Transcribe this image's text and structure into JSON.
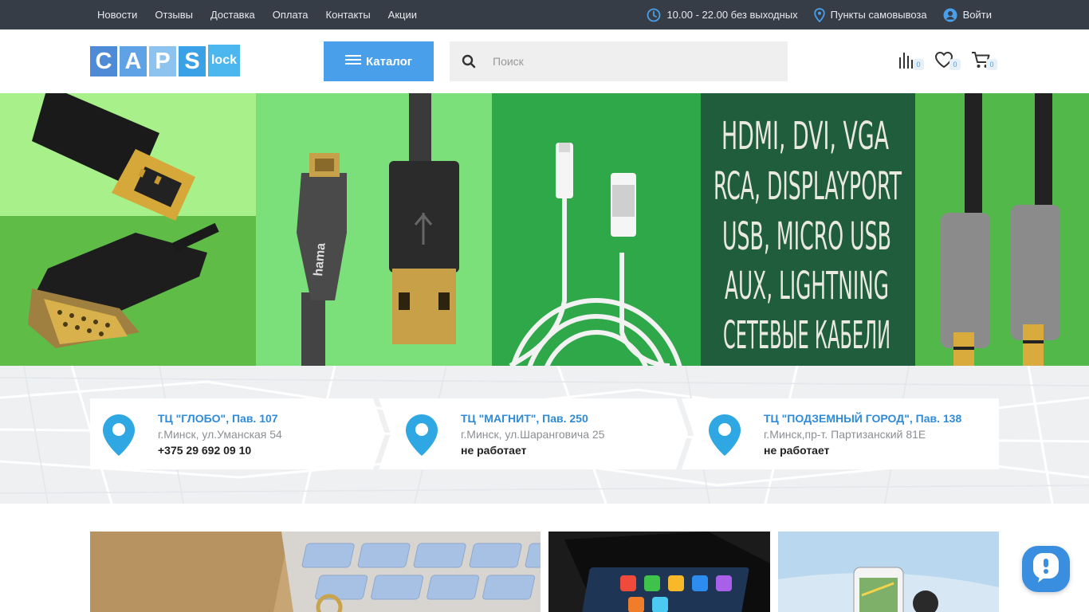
{
  "topbar": {
    "nav": [
      "Новости",
      "Отзывы",
      "Доставка",
      "Оплата",
      "Контакты",
      "Акции"
    ],
    "hours": "10.00 - 22.00 без выходных",
    "pickup": "Пункты самовывоза",
    "login": "Войти"
  },
  "header": {
    "logo_letters": [
      "C",
      "A",
      "P",
      "S"
    ],
    "logo_suffix": "lock",
    "catalog_label": "Каталог",
    "search_placeholder": "Поиск",
    "compare_count": "0",
    "favorites_count": "0",
    "cart_count": "0"
  },
  "banner": {
    "lines": [
      "HDMI, DVI, VGA",
      "RCA, DISPLAYPORT",
      "USB, MICRO USB",
      "AUX, LIGHTNING",
      "СЕТЕВЫЕ КАБЕЛИ"
    ],
    "slides": 4,
    "active_slide": 1
  },
  "stores": [
    {
      "title": "ТЦ \"ГЛОБО\", Пав. 107",
      "address": "г.Минск, ул.Уманская 54",
      "status": "+375 29 692 09 10"
    },
    {
      "title": "ТЦ \"МАГНИТ\", Пав. 250",
      "address": "г.Минск, ул.Шаранговича 25",
      "status": "не работает"
    },
    {
      "title": "ТЦ \"ПОДЗЕМНЫЙ ГОРОД\", Пав. 138",
      "address": "г.Минск,пр-т. Партизанский 81Е",
      "status": "не работает"
    }
  ],
  "colors": {
    "accent": "#4a9fea",
    "topbar": "#363d47",
    "link": "#2f8bd8",
    "pin": "#2fa7e3"
  }
}
